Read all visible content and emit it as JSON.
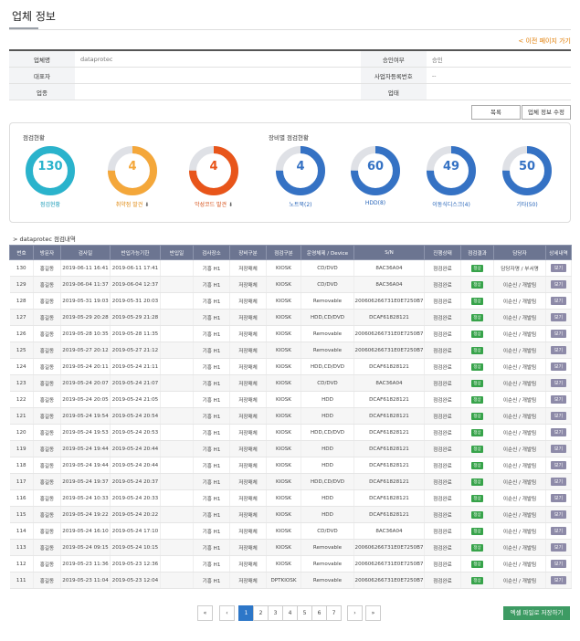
{
  "page": {
    "title": "업체 정보",
    "back_link": "< 이전 페이지 가기"
  },
  "info": {
    "rows": [
      [
        {
          "l": "업체명",
          "v": "dataprotec"
        },
        {
          "l": "승인여부",
          "v": "승인"
        }
      ],
      [
        {
          "l": "대표자",
          "v": ""
        },
        {
          "l": "사업자등록번호",
          "v": "--"
        }
      ],
      [
        {
          "l": "업종",
          "v": ""
        },
        {
          "l": "업태",
          "v": ""
        }
      ]
    ]
  },
  "buttons": {
    "list": "목록",
    "edit": "업체 정보 수정"
  },
  "stats": {
    "left_title": "점검현황",
    "right_title": "장비별 점검현황",
    "donuts": [
      {
        "value": "130",
        "label": "점검현황",
        "color": "#2ab3cc",
        "label_color": "#1a9bb8",
        "fraction": 1.0,
        "icon": false
      },
      {
        "value": "4",
        "label": "취약점 발견",
        "color": "#f4a73a",
        "label_color": "#e08a12",
        "fraction": 0.75,
        "icon": true
      },
      {
        "value": "4",
        "label": "악성코드 발견",
        "color": "#e8551a",
        "label_color": "#d44a10",
        "fraction": 0.75,
        "icon": true
      },
      {
        "value": "4",
        "label": "노트북(2)",
        "color": "#3572c4",
        "label_color": "#2563b8",
        "fraction": 0.75,
        "icon": false
      },
      {
        "value": "60",
        "label": "HDD(8)",
        "color": "#3572c4",
        "label_color": "#2563b8",
        "fraction": 0.75,
        "icon": false
      },
      {
        "value": "49",
        "label": "이동식디스크(4)",
        "color": "#3572c4",
        "label_color": "#2563b8",
        "fraction": 0.75,
        "icon": false
      },
      {
        "value": "50",
        "label": "기타(50)",
        "color": "#3572c4",
        "label_color": "#2563b8",
        "fraction": 0.75,
        "icon": false
      }
    ]
  },
  "list_title": "> dataprotec 점검내역",
  "table": {
    "headers": [
      "번호",
      "방문자",
      "검사일",
      "반입가능기한",
      "반입일",
      "검사장소",
      "장비구분",
      "점검구분",
      "운영체제 / Device",
      "S/N",
      "진행상태",
      "점검결과",
      "담당자",
      "상세내역"
    ],
    "ok_label": "정상",
    "view_label": "보기",
    "rows": [
      [
        "130",
        "홍길동",
        "2019-06-11 16:41",
        "2019-06-11 17:41",
        "",
        "기흥 H1",
        "저장매체",
        "KIOSK",
        "CD/DVD",
        "8AC36A04",
        "점검완료",
        "담당자명 / 부서명"
      ],
      [
        "129",
        "홍길동",
        "2019-06-04 11:37",
        "2019-06-04 12:37",
        "",
        "기흥 H1",
        "저장매체",
        "KIOSK",
        "CD/DVD",
        "8AC36A04",
        "점검완료",
        "이순신 / 개발팀"
      ],
      [
        "128",
        "홍길동",
        "2019-05-31 19:03",
        "2019-05-31 20:03",
        "",
        "기흥 H1",
        "저장매체",
        "KIOSK",
        "Removable",
        "200606266731E0E7250B7",
        "점검완료",
        "이순신 / 개발팀"
      ],
      [
        "127",
        "홍길동",
        "2019-05-29 20:28",
        "2019-05-29 21:28",
        "",
        "기흥 H1",
        "저장매체",
        "KIOSK",
        "HDD,CD/DVD",
        "DCAF61828121",
        "점검완료",
        "이순신 / 개발팀"
      ],
      [
        "126",
        "홍길동",
        "2019-05-28 10:35",
        "2019-05-28 11:35",
        "",
        "기흥 H1",
        "저장매체",
        "KIOSK",
        "Removable",
        "200606266731E0E7250B7",
        "점검완료",
        "이순신 / 개발팀"
      ],
      [
        "125",
        "홍길동",
        "2019-05-27 20:12",
        "2019-05-27 21:12",
        "",
        "기흥 H1",
        "저장매체",
        "KIOSK",
        "Removable",
        "200606266731E0E7250B7",
        "점검완료",
        "이순신 / 개발팀"
      ],
      [
        "124",
        "홍길동",
        "2019-05-24 20:11",
        "2019-05-24 21:11",
        "",
        "기흥 H1",
        "저장매체",
        "KIOSK",
        "HDD,CD/DVD",
        "DCAF61828121",
        "점검완료",
        "이순신 / 개발팀"
      ],
      [
        "123",
        "홍길동",
        "2019-05-24 20:07",
        "2019-05-24 21:07",
        "",
        "기흥 H1",
        "저장매체",
        "KIOSK",
        "CD/DVD",
        "8AC36A04",
        "점검완료",
        "이순신 / 개발팀"
      ],
      [
        "122",
        "홍길동",
        "2019-05-24 20:05",
        "2019-05-24 21:05",
        "",
        "기흥 H1",
        "저장매체",
        "KIOSK",
        "HDD",
        "DCAF61828121",
        "점검완료",
        "이순신 / 개발팀"
      ],
      [
        "121",
        "홍길동",
        "2019-05-24 19:54",
        "2019-05-24 20:54",
        "",
        "기흥 H1",
        "저장매체",
        "KIOSK",
        "HDD",
        "DCAF61828121",
        "점검완료",
        "이순신 / 개발팀"
      ],
      [
        "120",
        "홍길동",
        "2019-05-24 19:53",
        "2019-05-24 20:53",
        "",
        "기흥 H1",
        "저장매체",
        "KIOSK",
        "HDD,CD/DVD",
        "DCAF61828121",
        "점검완료",
        "이순신 / 개발팀"
      ],
      [
        "119",
        "홍길동",
        "2019-05-24 19:44",
        "2019-05-24 20:44",
        "",
        "기흥 H1",
        "저장매체",
        "KIOSK",
        "HDD",
        "DCAF61828121",
        "점검완료",
        "이순신 / 개발팀"
      ],
      [
        "118",
        "홍길동",
        "2019-05-24 19:44",
        "2019-05-24 20:44",
        "",
        "기흥 H1",
        "저장매체",
        "KIOSK",
        "HDD",
        "DCAF61828121",
        "점검완료",
        "이순신 / 개발팀"
      ],
      [
        "117",
        "홍길동",
        "2019-05-24 19:37",
        "2019-05-24 20:37",
        "",
        "기흥 H1",
        "저장매체",
        "KIOSK",
        "HDD,CD/DVD",
        "DCAF61828121",
        "점검완료",
        "이순신 / 개발팀"
      ],
      [
        "116",
        "홍길동",
        "2019-05-24 10:33",
        "2019-05-24 20:33",
        "",
        "기흥 H1",
        "저장매체",
        "KIOSK",
        "HDD",
        "DCAF61828121",
        "점검완료",
        "이순신 / 개발팀"
      ],
      [
        "115",
        "홍길동",
        "2019-05-24 19:22",
        "2019-05-24 20:22",
        "",
        "기흥 H1",
        "저장매체",
        "KIOSK",
        "HDD",
        "DCAF61828121",
        "점검완료",
        "이순신 / 개발팀"
      ],
      [
        "114",
        "홍길동",
        "2019-05-24 16:10",
        "2019-05-24 17:10",
        "",
        "기흥 H1",
        "저장매체",
        "KIOSK",
        "CD/DVD",
        "8AC36A04",
        "점검완료",
        "이순신 / 개발팀"
      ],
      [
        "113",
        "홍길동",
        "2019-05-24 09:15",
        "2019-05-24 10:15",
        "",
        "기흥 H1",
        "저장매체",
        "KIOSK",
        "Removable",
        "200606266731E0E7250B7",
        "점검완료",
        "이순신 / 개발팀"
      ],
      [
        "112",
        "홍길동",
        "2019-05-23 11:36",
        "2019-05-23 12:36",
        "",
        "기흥 H1",
        "저장매체",
        "KIOSK",
        "Removable",
        "200606266731E0E7250B7",
        "점검완료",
        "이순신 / 개발팀"
      ],
      [
        "111",
        "홍길동",
        "2019-05-23 11:04",
        "2019-05-23 12:04",
        "",
        "기흥 H1",
        "저장매체",
        "DPTKIOSK",
        "Removable",
        "200606266731E0E7250B7",
        "점검완료",
        "이순신 / 개발팀"
      ]
    ]
  },
  "pager": {
    "first": "«",
    "prev": "‹",
    "pages": [
      "1",
      "2",
      "3",
      "4",
      "5",
      "6",
      "7"
    ],
    "active": "1",
    "next": "›",
    "last": "»"
  },
  "excel_button": "엑셀 파일로 저장하기"
}
